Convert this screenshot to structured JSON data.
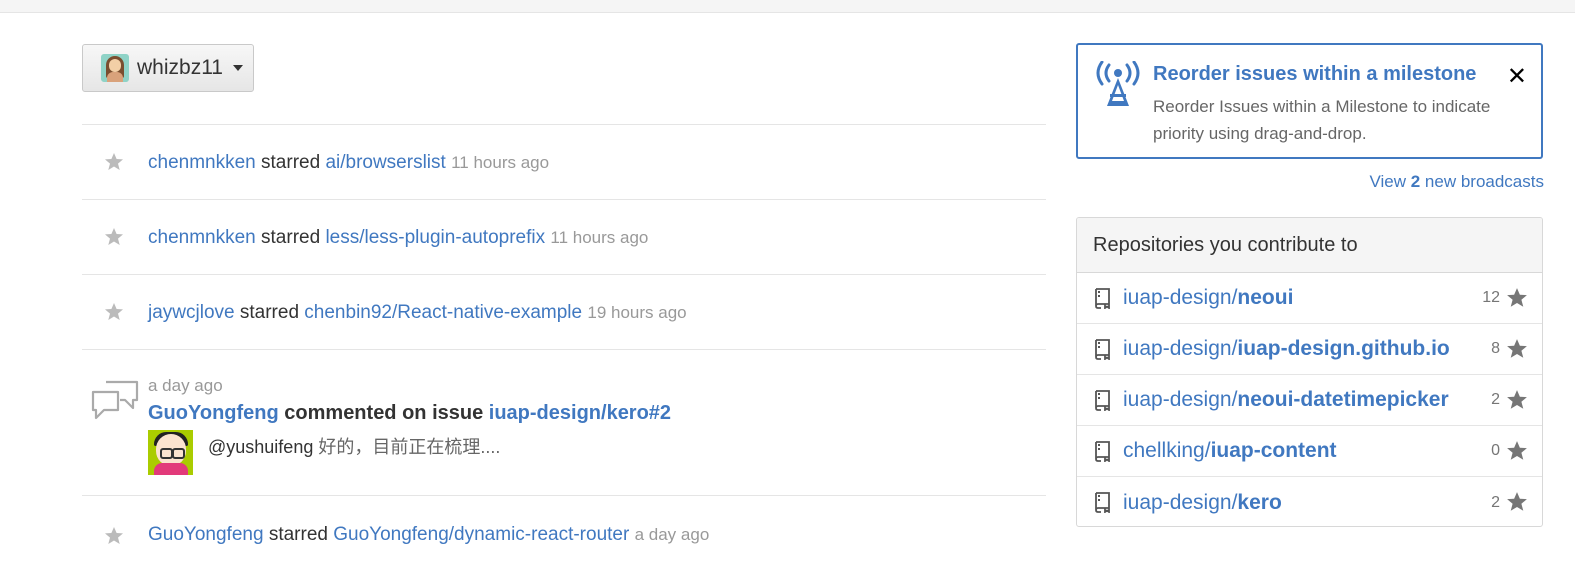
{
  "context": {
    "username": "whizbz11"
  },
  "feed": [
    {
      "type": "star",
      "actor": "chenmnkken",
      "verb": "starred",
      "repo": "ai/browserslist",
      "time": "11 hours ago"
    },
    {
      "type": "star",
      "actor": "chenmnkken",
      "verb": "starred",
      "repo": "less/less-plugin-autoprefix",
      "time": "11 hours ago"
    },
    {
      "type": "star",
      "actor": "jaywcjlove",
      "verb": "starred",
      "repo": "chenbin92/React-native-example",
      "time": "19 hours ago"
    },
    {
      "type": "comment",
      "time": "a day ago",
      "actor": "GuoYongfeng",
      "action": "commented on issue",
      "target": "iuap-design/kero#2",
      "mention": "@yushuifeng",
      "body": "好的，目前正在梳理...."
    },
    {
      "type": "star",
      "actor": "GuoYongfeng",
      "verb": "starred",
      "repo": "GuoYongfeng/dynamic-react-router",
      "time": "a day ago"
    }
  ],
  "broadcast": {
    "title": "Reorder issues within a milestone",
    "description": "Reorder Issues within a Milestone to indicate priority using drag-and-drop.",
    "close": "✕",
    "view_prefix": "View",
    "view_count": "2",
    "view_suffix": "new broadcasts"
  },
  "repos": {
    "header": "Repositories you contribute to",
    "items": [
      {
        "owner": "iuap-design/",
        "name": "neoui",
        "stars": "12"
      },
      {
        "owner": "iuap-design/",
        "name": "iuap-design.github.io",
        "stars": "8"
      },
      {
        "owner": "iuap-design/",
        "name": "neoui-datetimepicker",
        "stars": "2"
      },
      {
        "owner": "chellking/",
        "name": "iuap-content",
        "stars": "0"
      },
      {
        "owner": "iuap-design/",
        "name": "kero",
        "stars": "2"
      }
    ]
  },
  "colors": {
    "link": "#4078c0",
    "muted": "#999999",
    "border": "#e5e5e5"
  }
}
